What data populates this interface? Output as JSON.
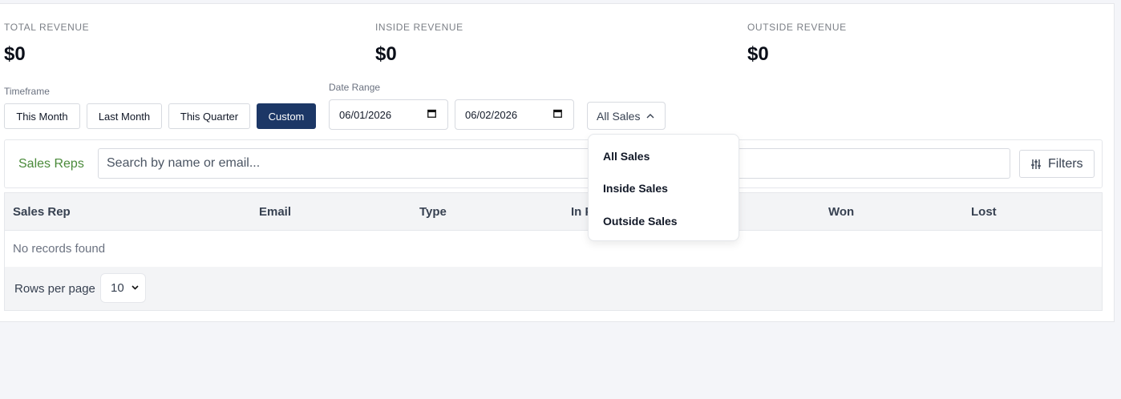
{
  "stats": [
    {
      "label": "TOTAL REVENUE",
      "value": "$0"
    },
    {
      "label": "INSIDE REVENUE",
      "value": "$0"
    },
    {
      "label": "OUTSIDE REVENUE",
      "value": "$0"
    }
  ],
  "timeframe": {
    "label": "Timeframe",
    "buttons": [
      "This Month",
      "Last Month",
      "This Quarter",
      "Custom"
    ],
    "active": "Custom"
  },
  "date_range": {
    "label": "Date Range",
    "start": "06/01/2026",
    "end": "06/02/2026"
  },
  "sales_type": {
    "selected": "All Sales",
    "options": [
      "All Sales",
      "Inside Sales",
      "Outside Sales"
    ],
    "menu_open": true
  },
  "sales_reps": {
    "title": "Sales Reps",
    "search_placeholder": "Search by name or email...",
    "filters_label": "Filters"
  },
  "table": {
    "columns": [
      "Sales Rep",
      "Email",
      "Type",
      "In P",
      "Won",
      "Lost"
    ],
    "empty_text": "No records found",
    "rows_per_page_label": "Rows per page",
    "rows_per_page": "10"
  },
  "colors": {
    "accent": "#1c3766",
    "panel_title": "#4a8a3a"
  }
}
